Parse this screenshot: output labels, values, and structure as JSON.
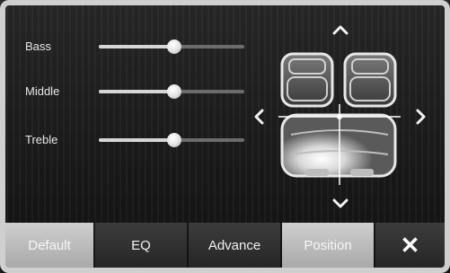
{
  "sliders": [
    {
      "label": "Bass",
      "level": 0.52
    },
    {
      "label": "Middle",
      "level": 0.52
    },
    {
      "label": "Treble",
      "level": 0.52
    }
  ],
  "position": {
    "arrows": {
      "up": "^",
      "down": "v",
      "left": "<",
      "right": ">"
    },
    "icon": "car-seat-map-icon"
  },
  "bottom_bar": {
    "tabs": [
      {
        "label": "Default",
        "style": "light"
      },
      {
        "label": "EQ",
        "style": "dark"
      },
      {
        "label": "Advance",
        "style": "dark"
      },
      {
        "label": "Position",
        "style": "light"
      }
    ],
    "close_label": "✕"
  },
  "colors": {
    "accent": "#cfcfcf",
    "background": "#1a1a1a",
    "track": "#6c6c6c",
    "highlight": "#ffffff"
  }
}
